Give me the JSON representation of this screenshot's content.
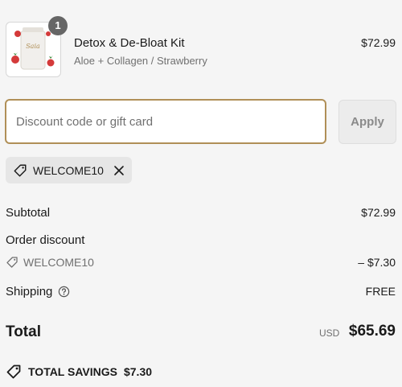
{
  "product": {
    "name": "Detox & De-Bloat Kit",
    "variant": "Aloe + Collagen / Strawberry",
    "price": "$72.99",
    "quantity": "1",
    "image_icon": "product-pack-image"
  },
  "discount": {
    "placeholder": "Discount code or gift card",
    "value": "",
    "apply_label": "Apply",
    "applied_code": "WELCOME10"
  },
  "summary": {
    "subtotal_label": "Subtotal",
    "subtotal_value": "$72.99",
    "order_discount_label": "Order discount",
    "discount_code": "WELCOME10",
    "discount_value": "– $7.30",
    "shipping_label": "Shipping",
    "shipping_value": "FREE",
    "total_label": "Total",
    "currency": "USD",
    "total_value": "$65.69",
    "savings_label": "TOTAL SAVINGS",
    "savings_value": "$7.30"
  },
  "colors": {
    "accent": "#b08f57",
    "badge": "#666666",
    "muted_text": "#707070"
  }
}
